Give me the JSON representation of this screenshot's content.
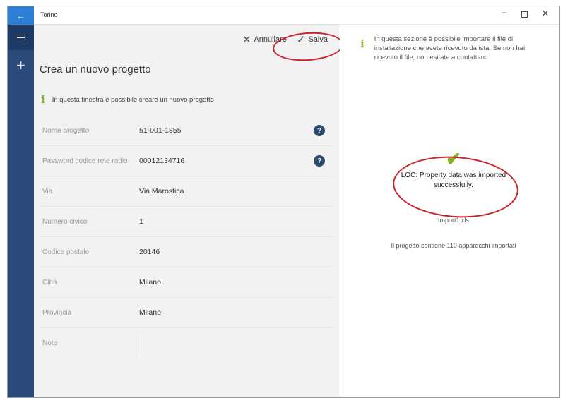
{
  "window": {
    "title": "Torino",
    "minimize_glyph": "–",
    "close_glyph": "✕"
  },
  "rail": {
    "back_icon": "←",
    "add_icon": "+"
  },
  "toolbar": {
    "cancel_label": "Annullare",
    "cancel_icon": "✕",
    "save_label": "Salva",
    "save_icon": "✓"
  },
  "left": {
    "title": "Crea un nuovo progetto",
    "info_icon": "i",
    "info_text": "In questa finestra è possibile creare un nuovo progetto",
    "fields": [
      {
        "label": "Nome progetto",
        "value": "51-001-1855",
        "help": "?"
      },
      {
        "label": "Password codice rete radio",
        "value": "00012134716",
        "help": "?"
      },
      {
        "label": "Via",
        "value": "Via Marostica"
      },
      {
        "label": "Numero civico",
        "value": "1"
      },
      {
        "label": "Codice postale",
        "value": "20146"
      },
      {
        "label": "Città",
        "value": "Milano"
      },
      {
        "label": "Provincia",
        "value": "Milano"
      },
      {
        "label": "Note",
        "value": ""
      }
    ]
  },
  "right": {
    "info_icon": "i",
    "info_text": "In questa sezione è possibile importare il file di installazione che avete ricevuto da ista. Se non hai ricevuto il file, non esitate a contattarci",
    "check_icon": "✔",
    "success_message": "LOC: Property data was imported successfully.",
    "filename": "Import1.xls",
    "count_message": "Il progetto contiene 110 apparecchi importati"
  },
  "colors": {
    "accent": "#2d7fd6",
    "rail": "#2b4a7a",
    "success_green": "#7cb321",
    "annotation_red": "#c8262b"
  }
}
